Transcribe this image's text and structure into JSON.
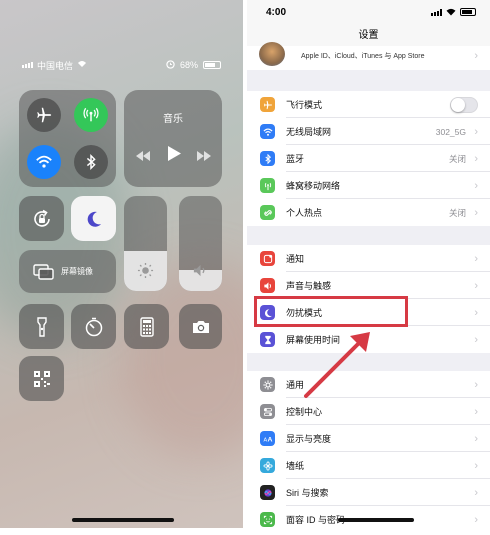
{
  "control_center": {
    "status": {
      "carrier": "中国电信",
      "battery": "68%"
    },
    "music_title": "音乐",
    "screen_mirroring_label": "屏幕镜像",
    "toggles": [
      {
        "name": "airplane-mode",
        "icon": "airplane-icon",
        "on": false
      },
      {
        "name": "cellular-data",
        "icon": "antenna-icon",
        "on": true,
        "color": "#34c759"
      },
      {
        "name": "wifi",
        "icon": "wifi-icon",
        "on": true,
        "color": "#1a82fb"
      },
      {
        "name": "bluetooth",
        "icon": "bluetooth-icon",
        "on": false
      }
    ],
    "brightness_level": 0.42,
    "volume_level": 0.22
  },
  "settings": {
    "status": {
      "time": "4:00"
    },
    "title": "设置",
    "apple_id_text": "Apple ID、iCloud、iTunes 与 App Store",
    "group1": [
      {
        "label": "飞行模式",
        "icon": "airplane-icon",
        "color": "#f0a43a",
        "type": "toggle"
      },
      {
        "label": "无线局域网",
        "icon": "wifi-icon",
        "color": "#2f7cf6",
        "value": "302_5G"
      },
      {
        "label": "蓝牙",
        "icon": "bluetooth-icon",
        "color": "#2f7cf6",
        "value": "关闭"
      },
      {
        "label": "蜂窝移动网络",
        "icon": "antenna-icon",
        "color": "#5ac85a",
        "value": ""
      },
      {
        "label": "个人热点",
        "icon": "link-icon",
        "color": "#5ac85a",
        "value": "关闭"
      }
    ],
    "group2": [
      {
        "label": "通知",
        "icon": "notification-icon",
        "color": "#e8453c"
      },
      {
        "label": "声音与触感",
        "icon": "speaker-icon",
        "color": "#e8453c"
      },
      {
        "label": "勿扰模式",
        "icon": "moon-icon",
        "color": "#5a52d6"
      },
      {
        "label": "屏幕使用时间",
        "icon": "hourglass-icon",
        "color": "#5a52d6"
      }
    ],
    "group3": [
      {
        "label": "通用",
        "icon": "gear-icon",
        "color": "#8e8e93"
      },
      {
        "label": "控制中心",
        "icon": "switches-icon",
        "color": "#8e8e93"
      },
      {
        "label": "显示与亮度",
        "icon": "text-size-icon",
        "color": "#2f7cf6"
      },
      {
        "label": "墙纸",
        "icon": "flower-icon",
        "color": "#35a9dc"
      },
      {
        "label": "Siri 与搜索",
        "icon": "siri-icon",
        "color": "#222222"
      },
      {
        "label": "面容 ID 与密码",
        "icon": "face-id-icon",
        "color": "#4cb94c"
      }
    ],
    "highlight_color": "#d63a44"
  }
}
